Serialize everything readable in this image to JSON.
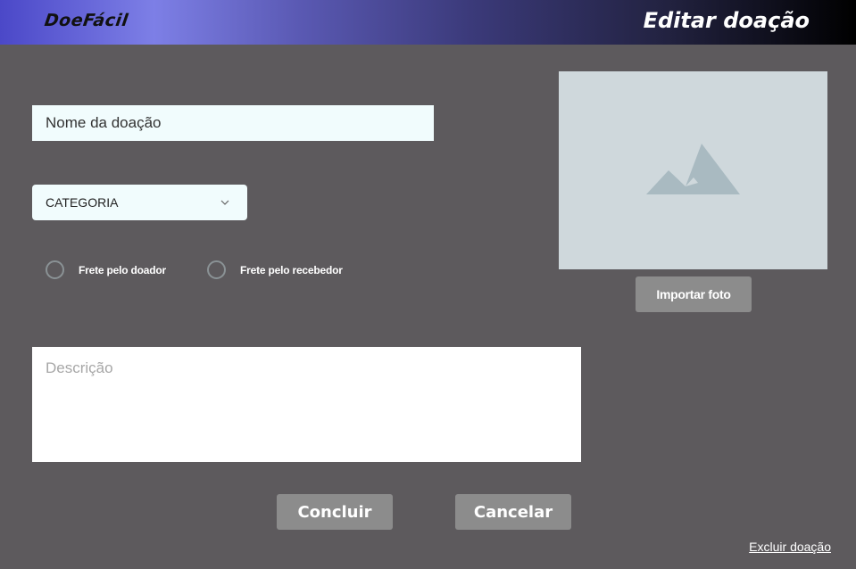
{
  "header": {
    "logo_text": "DoeFácil",
    "page_title": "Editar doação"
  },
  "form": {
    "name_placeholder": "Nome da doação",
    "category_label": "CATEGORIA",
    "radio_options": [
      {
        "label": "Frete pelo doador",
        "checked": false
      },
      {
        "label": "Frete pelo recebedor",
        "checked": false
      }
    ],
    "description_placeholder": "Descrição"
  },
  "photo": {
    "icon": "image-placeholder-icon",
    "import_label": "Importar foto"
  },
  "actions": {
    "confirm_label": "Concluir",
    "cancel_label": "Cancelar",
    "delete_label": "Excluir doação"
  },
  "colors": {
    "background": "#5d5a5d",
    "input_background": "#f1fcfd",
    "button_gray": "#8c8c8c",
    "photo_placeholder": "#cfd8dc",
    "header_gradient_start": "#4b48c8",
    "header_gradient_end": "#000000"
  }
}
